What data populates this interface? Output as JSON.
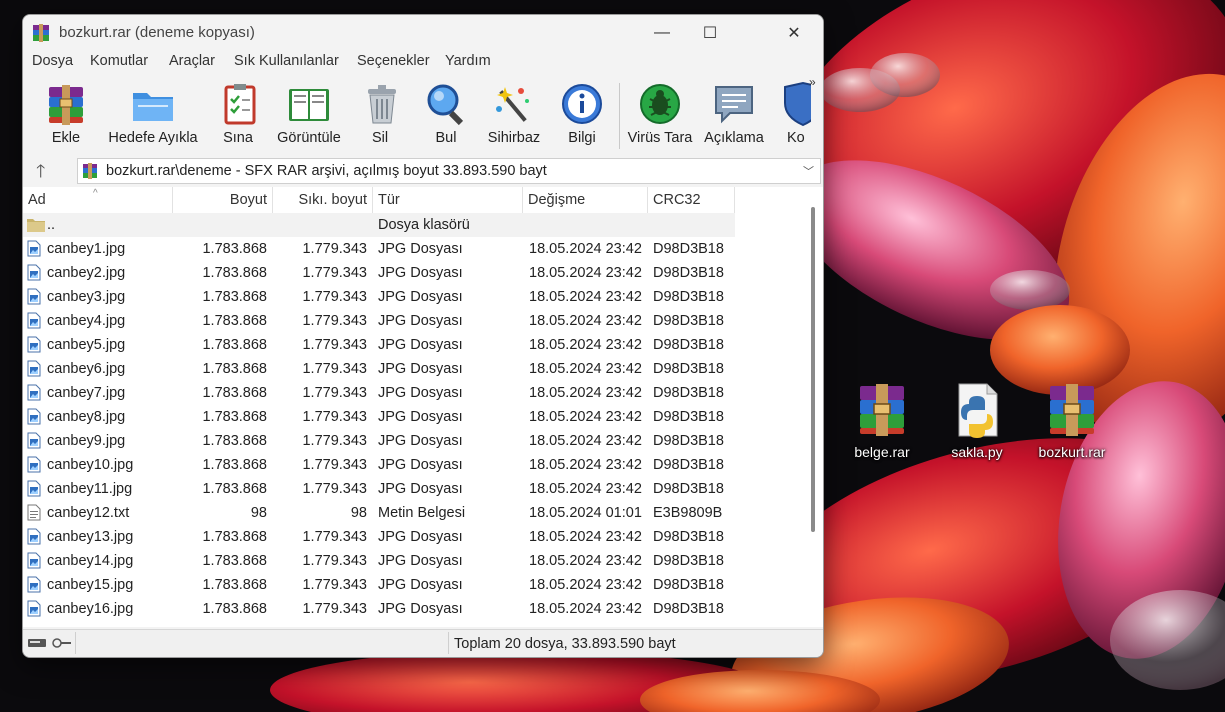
{
  "window": {
    "title": "bozkurt.rar (deneme kopyası)",
    "controls": {
      "minimize": "—",
      "maximize": "☐",
      "close": "✕"
    }
  },
  "menu": [
    "Dosya",
    "Komutlar",
    "Araçlar",
    "Sık Kullanılanlar",
    "Seçenekler",
    "Yardım"
  ],
  "toolbar": [
    {
      "label": "Ekle",
      "icon": "add-archive-icon"
    },
    {
      "label": "Hedefe Ayıkla",
      "icon": "extract-folder-icon"
    },
    {
      "label": "Sına",
      "icon": "test-clipboard-icon"
    },
    {
      "label": "Görüntüle",
      "icon": "view-book-icon"
    },
    {
      "label": "Sil",
      "icon": "trash-icon"
    },
    {
      "label": "Bul",
      "icon": "magnifier-icon"
    },
    {
      "label": "Sihirbaz",
      "icon": "wizard-wand-icon"
    },
    {
      "label": "Bilgi",
      "icon": "info-icon"
    },
    {
      "label": "Virüs Tara",
      "icon": "virus-scan-icon"
    },
    {
      "label": "Açıklama",
      "icon": "comment-icon"
    },
    {
      "label": "Ko",
      "icon": "protect-shield-icon"
    }
  ],
  "toolbar_more": "»",
  "address": {
    "up": "🡑",
    "path": "bozkurt.rar\\deneme - SFX RAR arşivi, açılmış boyut 33.893.590 bayt",
    "dropdown": "﹀"
  },
  "columns": {
    "name": "Ad",
    "size": "Boyut",
    "packed": "Sıkı. boyut",
    "type": "Tür",
    "modified": "Değişme",
    "crc": "CRC32"
  },
  "sort_indicator": "^",
  "files": [
    {
      "name": "..",
      "size": "",
      "packed": "",
      "type": "Dosya klasörü",
      "modified": "",
      "crc": "",
      "kind": "folder"
    },
    {
      "name": "canbey1.jpg",
      "size": "1.783.868",
      "packed": "1.779.343",
      "type": "JPG Dosyası",
      "modified": "18.05.2024 23:42",
      "crc": "D98D3B18",
      "kind": "jpg"
    },
    {
      "name": "canbey2.jpg",
      "size": "1.783.868",
      "packed": "1.779.343",
      "type": "JPG Dosyası",
      "modified": "18.05.2024 23:42",
      "crc": "D98D3B18",
      "kind": "jpg"
    },
    {
      "name": "canbey3.jpg",
      "size": "1.783.868",
      "packed": "1.779.343",
      "type": "JPG Dosyası",
      "modified": "18.05.2024 23:42",
      "crc": "D98D3B18",
      "kind": "jpg"
    },
    {
      "name": "canbey4.jpg",
      "size": "1.783.868",
      "packed": "1.779.343",
      "type": "JPG Dosyası",
      "modified": "18.05.2024 23:42",
      "crc": "D98D3B18",
      "kind": "jpg"
    },
    {
      "name": "canbey5.jpg",
      "size": "1.783.868",
      "packed": "1.779.343",
      "type": "JPG Dosyası",
      "modified": "18.05.2024 23:42",
      "crc": "D98D3B18",
      "kind": "jpg"
    },
    {
      "name": "canbey6.jpg",
      "size": "1.783.868",
      "packed": "1.779.343",
      "type": "JPG Dosyası",
      "modified": "18.05.2024 23:42",
      "crc": "D98D3B18",
      "kind": "jpg"
    },
    {
      "name": "canbey7.jpg",
      "size": "1.783.868",
      "packed": "1.779.343",
      "type": "JPG Dosyası",
      "modified": "18.05.2024 23:42",
      "crc": "D98D3B18",
      "kind": "jpg"
    },
    {
      "name": "canbey8.jpg",
      "size": "1.783.868",
      "packed": "1.779.343",
      "type": "JPG Dosyası",
      "modified": "18.05.2024 23:42",
      "crc": "D98D3B18",
      "kind": "jpg"
    },
    {
      "name": "canbey9.jpg",
      "size": "1.783.868",
      "packed": "1.779.343",
      "type": "JPG Dosyası",
      "modified": "18.05.2024 23:42",
      "crc": "D98D3B18",
      "kind": "jpg"
    },
    {
      "name": "canbey10.jpg",
      "size": "1.783.868",
      "packed": "1.779.343",
      "type": "JPG Dosyası",
      "modified": "18.05.2024 23:42",
      "crc": "D98D3B18",
      "kind": "jpg"
    },
    {
      "name": "canbey11.jpg",
      "size": "1.783.868",
      "packed": "1.779.343",
      "type": "JPG Dosyası",
      "modified": "18.05.2024 23:42",
      "crc": "D98D3B18",
      "kind": "jpg"
    },
    {
      "name": "canbey12.txt",
      "size": "98",
      "packed": "98",
      "type": "Metin Belgesi",
      "modified": "18.05.2024 01:01",
      "crc": "E3B9809B",
      "kind": "txt"
    },
    {
      "name": "canbey13.jpg",
      "size": "1.783.868",
      "packed": "1.779.343",
      "type": "JPG Dosyası",
      "modified": "18.05.2024 23:42",
      "crc": "D98D3B18",
      "kind": "jpg"
    },
    {
      "name": "canbey14.jpg",
      "size": "1.783.868",
      "packed": "1.779.343",
      "type": "JPG Dosyası",
      "modified": "18.05.2024 23:42",
      "crc": "D98D3B18",
      "kind": "jpg"
    },
    {
      "name": "canbey15.jpg",
      "size": "1.783.868",
      "packed": "1.779.343",
      "type": "JPG Dosyası",
      "modified": "18.05.2024 23:42",
      "crc": "D98D3B18",
      "kind": "jpg"
    },
    {
      "name": "canbey16.jpg",
      "size": "1.783.868",
      "packed": "1.779.343",
      "type": "JPG Dosyası",
      "modified": "18.05.2024 23:42",
      "crc": "D98D3B18",
      "kind": "jpg"
    }
  ],
  "status": {
    "summary": "Toplam 20 dosya, 33.893.590 bayt"
  },
  "desktop_icons": [
    {
      "label": "belge.rar",
      "icon": "winrar-archive-icon"
    },
    {
      "label": "sakla.py",
      "icon": "python-file-icon"
    },
    {
      "label": "bozkurt.rar",
      "icon": "winrar-archive-icon"
    }
  ],
  "colors": {
    "window_bg": "#f3f3f3",
    "list_bg": "#ffffff",
    "wallpaper_dark": "#0b0a0d",
    "petal_red": "#c4122a",
    "petal_orange": "#f0642a",
    "petal_pink": "#d84a78"
  }
}
